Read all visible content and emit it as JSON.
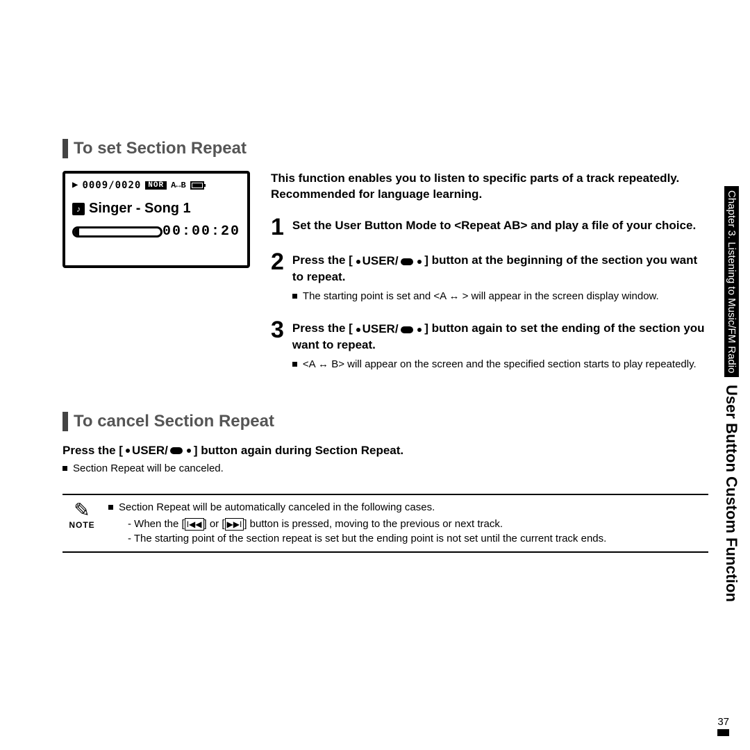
{
  "sidebar": {
    "chapter": "Chapter 3.  Listening to Music/FM Radio",
    "feature": "User Button Custom Function"
  },
  "page_number": "37",
  "lcd": {
    "counter": "0009/0020",
    "nor": "NOR",
    "ab": "A↔B",
    "song": "Singer - Song 1",
    "time": "00:00:20"
  },
  "set": {
    "heading": "To set Section Repeat",
    "intro": "This function enables you to listen to specific parts of a track repeatedly. Recommended for language learning.",
    "step1": "Set the User Button Mode to <Repeat AB> and play a file of your choice.",
    "step2_a": "Press the [",
    "step2_b": " USER/",
    "step2_c": "] button at the beginning of the section you want to repeat.",
    "step2_bullet": "The starting point is set and <A ↔ > will appear in the screen display window.",
    "step3_a": "Press the [",
    "step3_b": " USER/",
    "step3_c": "] button again to set the ending of the section you want to repeat.",
    "step3_bullet": "<A ↔ B> will appear on the screen and the specified section starts to play repeatedly."
  },
  "cancel": {
    "heading": "To cancel Section Repeat",
    "line_a": "Press the [",
    "line_b": " USER/",
    "line_c": "] button again during Section Repeat.",
    "bullet": "Section Repeat will be canceled."
  },
  "note": {
    "label": "NOTE",
    "line1": "Section Repeat will be automatically canceled in the following cases.",
    "line2_a": "- When the [",
    "line2_prev": "I◀◀",
    "line2_mid": "] or [",
    "line2_next": "▶▶I",
    "line2_b": "] button is pressed, moving to the previous or next track.",
    "line3": "- The starting point of the section repeat is set but the ending point is not set until the current track ends."
  }
}
